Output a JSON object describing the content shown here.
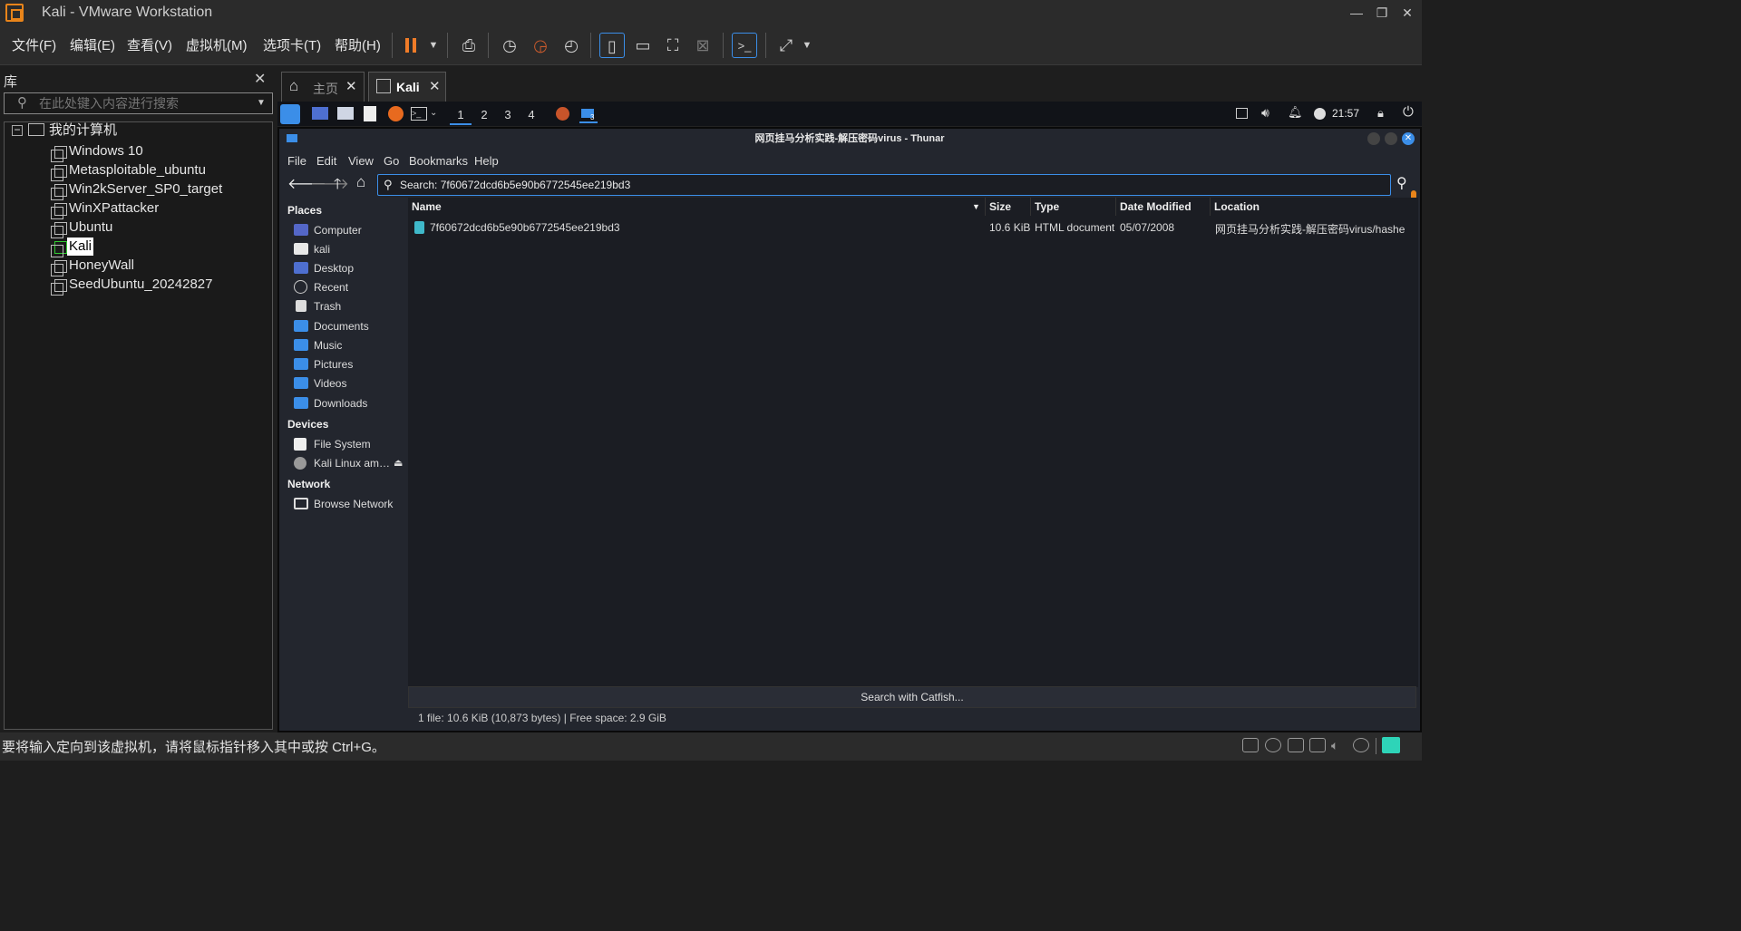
{
  "window": {
    "title": "Kali - VMware Workstation"
  },
  "vm_menu": [
    "文件(F)",
    "编辑(E)",
    "查看(V)",
    "虚拟机(M)",
    "选项卡(T)",
    "帮助(H)"
  ],
  "library": {
    "title": "库",
    "search_placeholder": "在此处键入内容进行搜索",
    "root": "我的计算机",
    "vms": [
      "Windows 10",
      "Metasploitable_ubuntu",
      "Win2kServer_SP0_target",
      "WinXPattacker",
      "Ubuntu",
      "Kali",
      "HoneyWall",
      "SeedUbuntu_20242827"
    ],
    "selected": "Kali"
  },
  "vm_tabs": [
    {
      "label": "主页"
    },
    {
      "label": "Kali"
    }
  ],
  "xfce": {
    "workspaces": [
      "1",
      "2",
      "3",
      "4"
    ],
    "active_workspace": "1",
    "files_badge": "3",
    "clock": "21:57"
  },
  "thunar": {
    "title": "网页挂马分析实践-解压密码virus - Thunar",
    "menu": [
      "File",
      "Edit",
      "View",
      "Go",
      "Bookmarks",
      "Help"
    ],
    "location": "Search: 7f60672dcd6b5e90b6772545ee219bd3",
    "places_label": "Places",
    "places": [
      "Computer",
      "kali",
      "Desktop",
      "Recent",
      "Trash",
      "Documents",
      "Music",
      "Pictures",
      "Videos",
      "Downloads"
    ],
    "devices_label": "Devices",
    "devices": [
      "File System",
      "Kali Linux am…"
    ],
    "network_label": "Network",
    "network": [
      "Browse Network"
    ],
    "columns": [
      "Name",
      "Size",
      "Type",
      "Date Modified",
      "Location"
    ],
    "files": [
      {
        "name": "7f60672dcd6b5e90b6772545ee219bd3",
        "size": "10.6 KiB",
        "type": "HTML document",
        "modified": "05/07/2008",
        "location": "网页挂马分析实践-解压密码virus/hashe"
      }
    ],
    "catfish_button": "Search with Catfish...",
    "status": "1 file: 10.6 KiB (10,873 bytes)  |  Free space: 2.9 GiB"
  },
  "status_bar": {
    "message": "要将输入定向到该虚拟机，请将鼠标指针移入其中或按 Ctrl+G。"
  },
  "colors": {
    "accent": "#3b8ee8",
    "vmware_orange": "#e8841a",
    "pause": "#f07c28"
  }
}
